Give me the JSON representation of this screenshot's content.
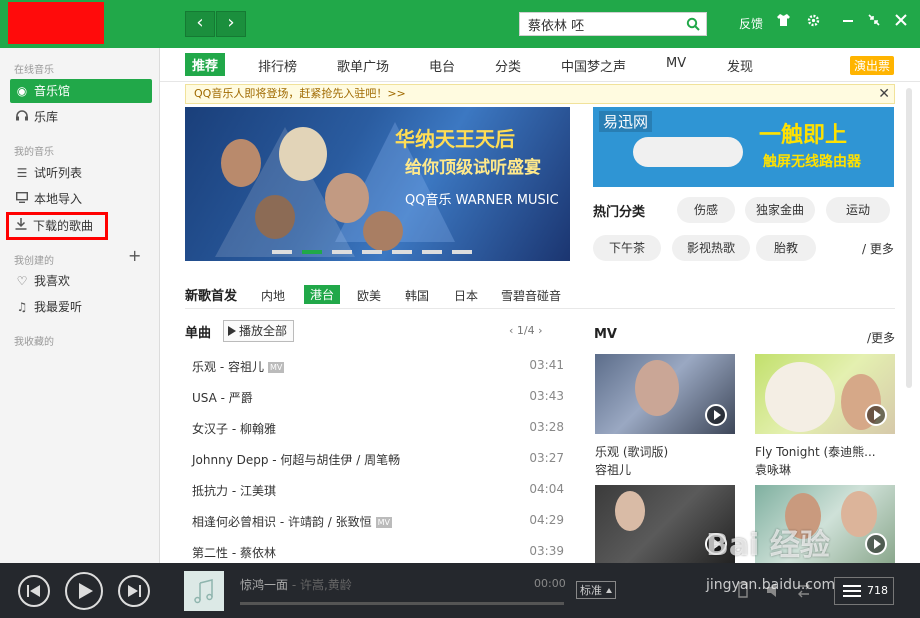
{
  "topbar": {
    "back_label": "‹",
    "forward_label": "›",
    "search_value": "蔡依林 呸",
    "feedback_label": "反馈"
  },
  "sidebar": {
    "sections": [
      {
        "heading": "在线音乐"
      },
      {
        "heading": "我的音乐"
      },
      {
        "heading": "我创建的"
      },
      {
        "heading": "我收藏的"
      }
    ],
    "items": [
      {
        "label": "音乐馆"
      },
      {
        "label": "乐库"
      },
      {
        "label": "试听列表"
      },
      {
        "label": "本地导入"
      },
      {
        "label": "下载的歌曲"
      },
      {
        "label": "我喜欢"
      },
      {
        "label": "我最爱听"
      }
    ],
    "add_label": "+"
  },
  "tabs": [
    {
      "label": "推荐"
    },
    {
      "label": "排行榜"
    },
    {
      "label": "歌单广场"
    },
    {
      "label": "电台"
    },
    {
      "label": "分类"
    },
    {
      "label": "中国梦之声"
    },
    {
      "label": "MV"
    },
    {
      "label": "发现"
    }
  ],
  "ticket_label": "演出票",
  "notice": {
    "text": "QQ音乐人即将登场，赶紧抢先入驻吧！>>",
    "close": "✕"
  },
  "banner": {
    "line1": "华纳天王天后",
    "line2": "给你顶级试听盛宴",
    "line3": "QQ音乐  WARNER MUSIC"
  },
  "ad": {
    "logo": "易迅网",
    "line1": "一触即上",
    "line2": "触屏无线路由器"
  },
  "hot": {
    "title": "热门分类",
    "pills": [
      "伤感",
      "独家金曲",
      "运动",
      "下午茶",
      "影视热歌",
      "胎教"
    ],
    "more": "/ 更多"
  },
  "newsongs": {
    "title": "新歌首发",
    "tabs": [
      "内地",
      "港台",
      "欧美",
      "韩国",
      "日本",
      "雪碧音碰音"
    ]
  },
  "singles": {
    "title": "单曲",
    "play_all": "播放全部",
    "pager": "‹  1/4  ›",
    "songs": [
      {
        "title": "乐观 - 容祖儿",
        "mv": "MV",
        "duration": "03:41"
      },
      {
        "title": "USA - 严爵",
        "mv": "",
        "duration": "03:43"
      },
      {
        "title": "女汉子 - 柳翰雅",
        "mv": "",
        "duration": "03:28"
      },
      {
        "title": "Johnny Depp - 何超与胡佳伊 / 周笔畅",
        "mv": "",
        "duration": "03:27"
      },
      {
        "title": "抵抗力 - 江美琪",
        "mv": "",
        "duration": "04:04"
      },
      {
        "title": "相逢何必曾相识 - 许靖韵 / 张致恒",
        "mv": "MV",
        "duration": "04:29"
      },
      {
        "title": "第二性 - 蔡依林",
        "mv": "",
        "duration": "03:39"
      }
    ]
  },
  "mv": {
    "title": "MV",
    "more": "/更多",
    "items": [
      {
        "title": "乐观 (歌词版)",
        "artist": "容祖儿"
      },
      {
        "title": "Fly Tonight (泰迪熊...",
        "artist": "袁咏琳"
      }
    ]
  },
  "player": {
    "track": "惊鸿一面",
    "artist": " - 许嵩,黄龄",
    "time": "00:00",
    "quality": "标准",
    "playlist_count": "718"
  },
  "watermark": {
    "main": "Bai 经验",
    "sub": "jingyan.baidu.com"
  },
  "colors": {
    "brand": "#21a849",
    "highlight_box": "#ff0000",
    "player_bg": "#25282d"
  }
}
